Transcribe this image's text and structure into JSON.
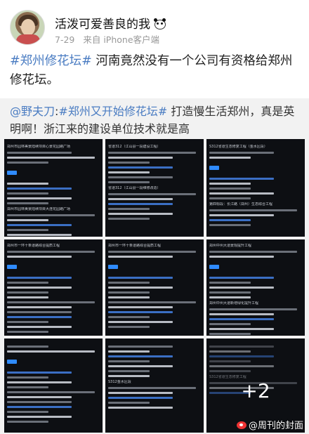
{
  "author": {
    "name": "活泼可爱善良的我",
    "date": "7-29",
    "source": "来自 iPhone客户端"
  },
  "post": {
    "hashtag": "#郑州修花坛#",
    "text_after_hashtag": " 河南竟然没有一个公司有资格给郑州修花坛。"
  },
  "repost": {
    "mention": "@野夫刀",
    "text_after_mention": ":",
    "hashtag1": "#郑州又开始修花坛#",
    "text_mid": " 打造慢生活郑州，真是英明啊！浙江来的建设单位技术就是高"
  },
  "images": {
    "more_count": "+2",
    "img1_title": "郑州市园林美景陆续项目心景花园路广场",
    "img1_mid": "郑州市园林美景陆续项目大连花园路广场",
    "img2_title": "省道312（江山县一段建设工程）",
    "img2_mid": "省道312（江山县一段维修改造）",
    "img3_title": "S312省道生态修复工程（金水区段）",
    "img3_mid": "第四标段：长江路（郑州）生态综合工程",
    "img4_title": "郑州市一环十条道路综合提质工程",
    "img5_title": "郑州市一环十条道路综合提质工程",
    "img6_title": "郑州中州大道景观提升工程",
    "img6_mid": "郑州中州大道新增绿化提升工程",
    "img8_title": "S312金水区段",
    "img9_title": "S312省道生态修复工程"
  },
  "watermark": "@周刊的封面"
}
